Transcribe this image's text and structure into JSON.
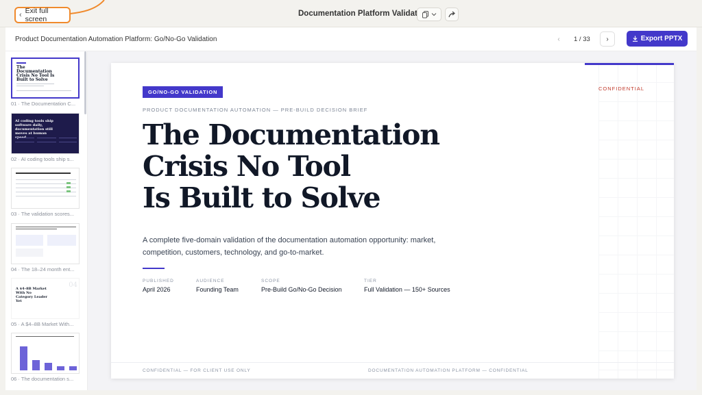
{
  "topbar": {
    "exit_label": "Exit full screen",
    "title": "Documentation Platform Validation",
    "icons": {
      "exit": "chevron-left-icon",
      "copy": "copy-icon",
      "copy_menu": "chevron-down-icon",
      "share": "share-icon"
    }
  },
  "subbar": {
    "deck_title": "Product Documentation Automation Platform: Go/No-Go Validation",
    "page_indicator": "1 / 33",
    "prev_glyph": "‹",
    "next_glyph": "›",
    "export_label": "Export PPTX",
    "export_icon": "download-icon"
  },
  "sidebar": {
    "thumbnails": [
      {
        "label": "01 · The Documentation C...",
        "title": "The Documentation Crisis No Tool Is Built to Solve"
      },
      {
        "label": "02 · AI coding tools ship s...",
        "title": "AI coding tools ship software daily, documentation still moves at human speed."
      },
      {
        "label": "03 · The validation scores..."
      },
      {
        "label": "04 · The 18–24 month ent..."
      },
      {
        "label": "05 · A $4–8B Market With...",
        "title": "A $4–8B Market With No Category Leader Yet",
        "number": "04"
      },
      {
        "label": "06 · The documentation s..."
      }
    ]
  },
  "slide": {
    "tag": "GO/NO-GO VALIDATION",
    "confidential": "CONFIDENTIAL",
    "eyebrow": "PRODUCT DOCUMENTATION AUTOMATION — PRE-BUILD DECISION BRIEF",
    "headline_1": "The Documentation",
    "headline_2": "Crisis No Tool",
    "headline_3": "Is Built to Solve",
    "lede": "A complete five-domain validation of the documentation automation opportunity: market, competition, customers, technology, and go-to-market.",
    "meta": [
      {
        "key": "PUBLISHED",
        "value": "April 2026"
      },
      {
        "key": "AUDIENCE",
        "value": "Founding Team"
      },
      {
        "key": "SCOPE",
        "value": "Pre-Build Go/No-Go Decision"
      },
      {
        "key": "TIER",
        "value": "Full Validation — 150+ Sources"
      }
    ],
    "footer_left": "CONFIDENTIAL — FOR CLIENT USE ONLY",
    "footer_right": "DOCUMENTATION AUTOMATION PLATFORM — CONFIDENTIAL"
  },
  "colors": {
    "accent": "#4338ca",
    "highlight": "#f08a2c",
    "confidential": "#c0392b"
  }
}
